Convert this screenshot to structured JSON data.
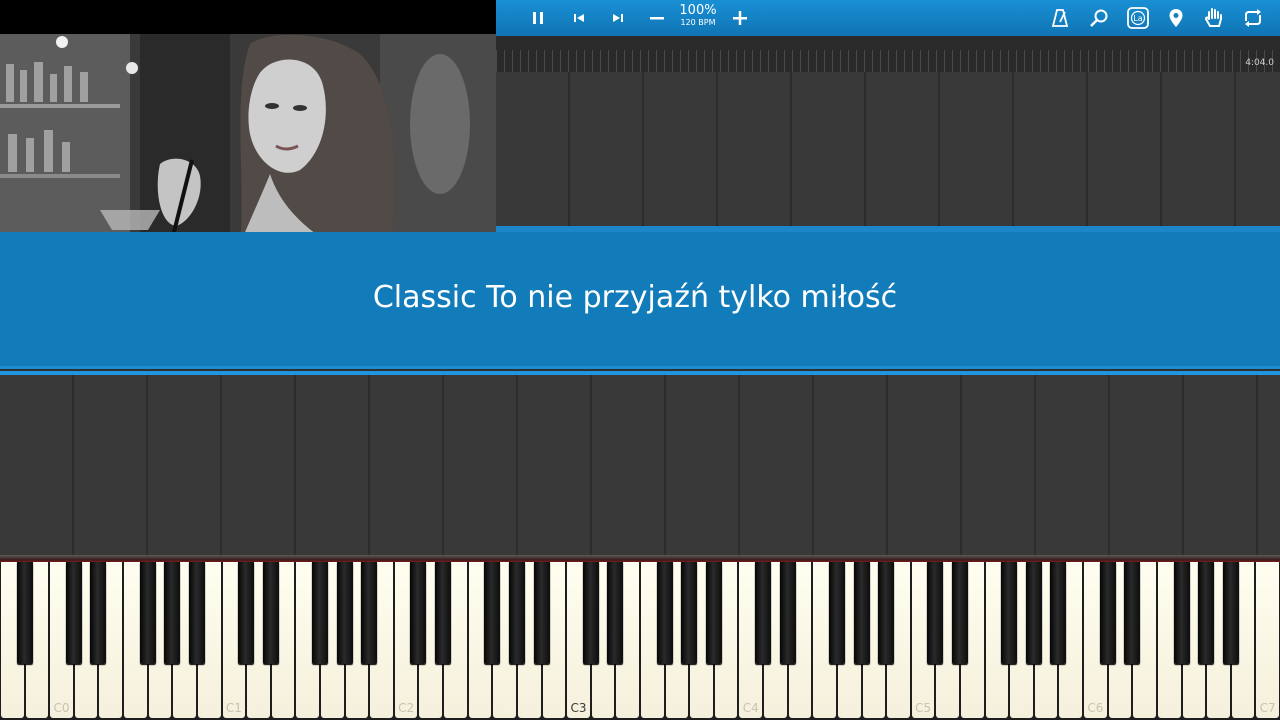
{
  "toolbar": {
    "speed_percent": "100%",
    "tempo": "120 BPM",
    "icons": [
      "pause-icon",
      "rewind-icon",
      "forward-icon",
      "minus-icon",
      "plus-icon",
      "metronome-icon",
      "search-icon",
      "label-icon",
      "marker-icon",
      "hand-icon",
      "loop-icon"
    ],
    "label_button": "La"
  },
  "timeline": {
    "duration": "4:04.0"
  },
  "lyric": {
    "text": "Classic To nie przyjaźń tylko miłość"
  },
  "keyboard": {
    "octave_labels": [
      "C0",
      "C1",
      "C2",
      "C3",
      "C4",
      "C5",
      "C6",
      "C7"
    ],
    "highlighted_label": "C3"
  },
  "colors": {
    "accent": "#117cb9",
    "toolbar": "#1686c9",
    "background": "#393939"
  }
}
